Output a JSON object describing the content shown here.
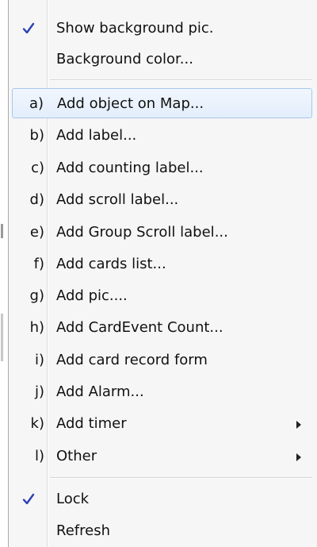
{
  "menu": {
    "top_items": [
      {
        "label": "Show background pic.",
        "checked": true
      },
      {
        "label": "Background color...",
        "checked": false
      }
    ],
    "items": [
      {
        "key": "a)",
        "label": "Add object on Map..."
      },
      {
        "key": "b)",
        "label": "Add label..."
      },
      {
        "key": "c)",
        "label": "Add counting label..."
      },
      {
        "key": "d)",
        "label": "Add scroll label..."
      },
      {
        "key": "e)",
        "label": "Add Group Scroll label..."
      },
      {
        "key": "f)",
        "label": "Add cards list..."
      },
      {
        "key": "g)",
        "label": "Add pic...."
      },
      {
        "key": "h)",
        "label": "Add CardEvent Count..."
      },
      {
        "key": "i)",
        "label": "Add card record form"
      },
      {
        "key": "j)",
        "label": "Add Alarm..."
      },
      {
        "key": "k)",
        "label": "Add timer",
        "submenu": true
      },
      {
        "key": "l)",
        "label": "Other",
        "submenu": true
      }
    ],
    "bottom_items": [
      {
        "label": "Lock",
        "checked": true
      },
      {
        "label": "Refresh",
        "checked": false
      }
    ],
    "highlighted_index": 0,
    "check_color": "#2b3fb5",
    "highlight_border": "#a8c8ee"
  }
}
